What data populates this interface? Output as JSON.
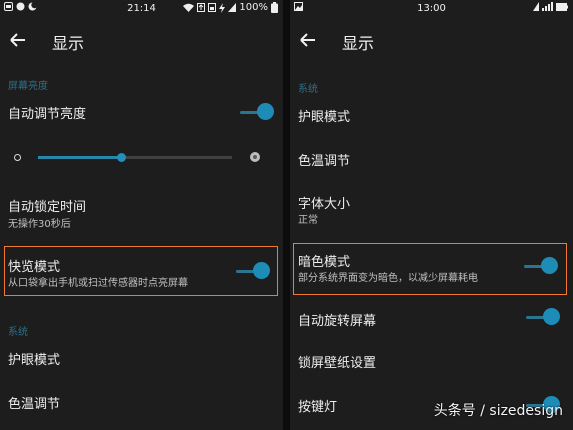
{
  "left": {
    "status": {
      "time": "21:14",
      "battery": "100%"
    },
    "header": {
      "back_icon": "arrow-left-icon",
      "title": "显示"
    },
    "section_brightness": "屏幕亮度",
    "auto_brightness": {
      "label": "自动调节亮度",
      "on": true
    },
    "brightness_level": 0.43,
    "auto_lock": {
      "label": "自动锁定时间",
      "sub": "无操作30秒后"
    },
    "quick_view": {
      "label": "快览模式",
      "sub": "从口袋拿出手机或扫过传感器时点亮屏幕",
      "on": true
    },
    "section_system": "系统",
    "eye_care": "护眼模式",
    "color_temp": "色温调节"
  },
  "right": {
    "status": {
      "time": "13:00"
    },
    "header": {
      "back_icon": "arrow-left-icon",
      "title": "显示"
    },
    "section_system": "系统",
    "eye_care": "护眼模式",
    "color_temp": "色温调节",
    "font_size": {
      "label": "字体大小",
      "sub": "正常"
    },
    "dark_mode": {
      "label": "暗色模式",
      "sub": "部分系统界面变为暗色，以减少屏幕耗电",
      "on": true
    },
    "auto_rotate": {
      "label": "自动旋转屏幕",
      "on": true
    },
    "lock_wallpaper": "锁屏壁纸设置",
    "key_light": {
      "label": "按键灯",
      "on": true
    }
  },
  "colors": {
    "accent": "#1d8cb7",
    "section": "#2f6f86",
    "highlight": "#f07a35"
  },
  "watermark": "头条号 / sizedesign"
}
